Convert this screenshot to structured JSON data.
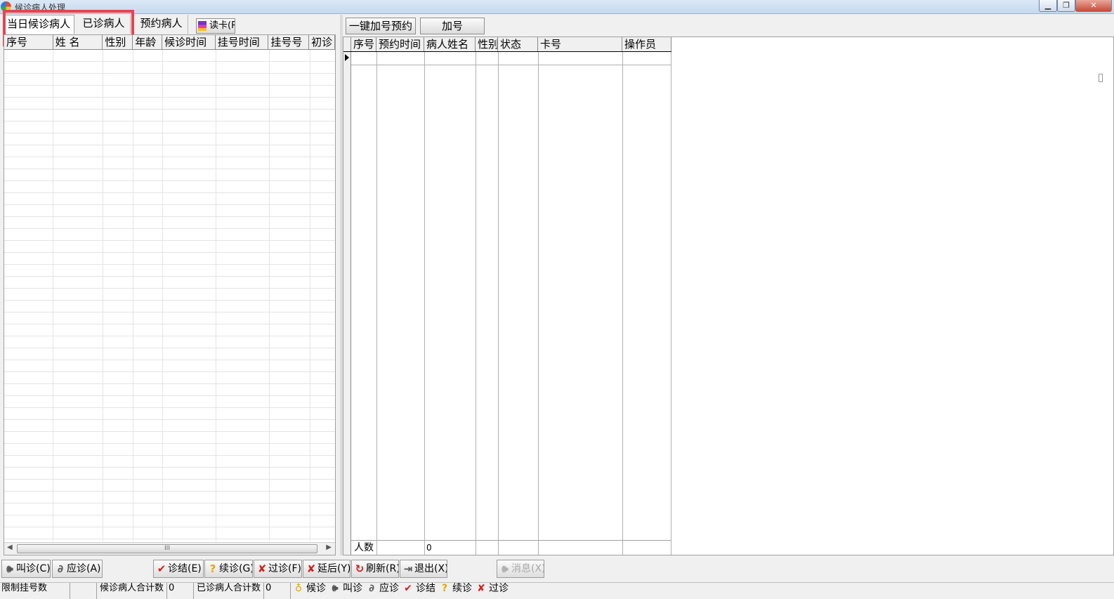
{
  "window": {
    "title": "候诊病人处理",
    "min_glyph": "▁",
    "max_glyph": "❐",
    "close_glyph": "✕"
  },
  "left": {
    "tabs": [
      "当日候诊病人",
      "已诊病人",
      "预约病人"
    ],
    "read_card": "读卡(R)",
    "columns": [
      "序号",
      "姓  名",
      "性别",
      "年龄",
      "候诊时间",
      "挂号时间",
      "挂号号",
      "初诊"
    ],
    "scroll_thumb": "III"
  },
  "right": {
    "buttons": {
      "one_key": "一键加号预约",
      "add_number": "加号"
    },
    "columns": [
      "序号",
      "预约时间",
      "病人姓名",
      "性别",
      "状态",
      "卡号",
      "操作员"
    ],
    "footer": {
      "label": "人数",
      "value": "0"
    }
  },
  "toolbar": {
    "call": "叫诊(C)",
    "respond": "应诊(A)",
    "finish": "诊结(E)",
    "continue": "续诊(G)",
    "pass": "过诊(F)",
    "delay": "延后(Y)",
    "refresh": "刷新(R)",
    "exit": "退出(X)",
    "message": "消息(X)"
  },
  "icons": {
    "call": "speaker-icon",
    "respond": "stethoscope-icon",
    "finish": "check-icon",
    "continue": "question-icon",
    "pass": "x-icon",
    "delay": "x-icon",
    "refresh": "refresh-icon",
    "exit": "exit-icon",
    "message": "speaker-icon"
  },
  "status": {
    "limit_label": "限制挂号数",
    "limit_value": "",
    "waiting_label": "候诊病人合计数",
    "waiting_value": "0",
    "seen_label": "已诊病人合计数",
    "seen_value": "0",
    "legend": [
      "候诊",
      "叫诊",
      "应诊",
      "诊结",
      "续诊",
      "过诊"
    ]
  },
  "colors": {
    "highlight": "#e8434f",
    "accent_red": "#d41f1f",
    "accent_yellow": "#e5a800"
  }
}
